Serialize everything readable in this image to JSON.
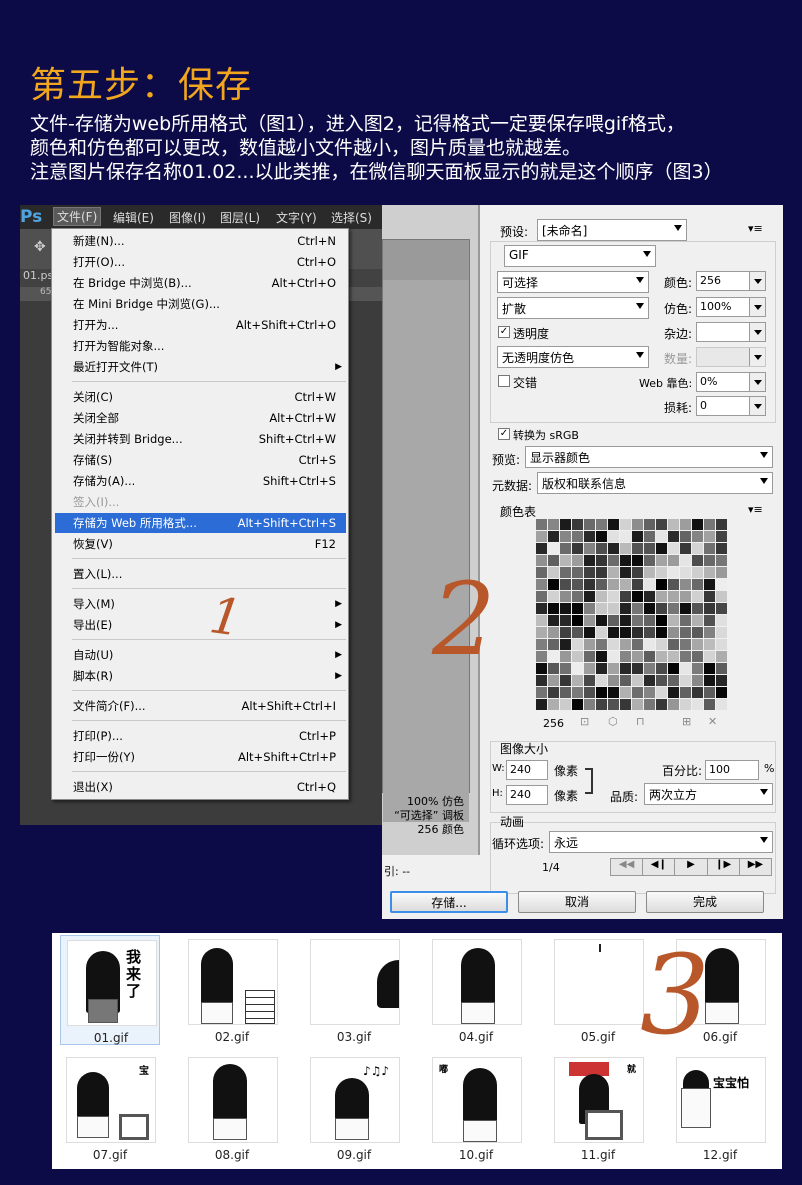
{
  "heading": "第五步：保存",
  "description": [
    "文件-存储为web所用格式（图1），进入图2，记得格式一定要保存喂gif格式，",
    "颜色和仿色都可以更改，数值越小文件越小，图片质量也就越差。",
    "注意图片保存名称01.02...以此类推，在微信聊天面板显示的就是这个顺序（图3）"
  ],
  "ps": {
    "logo": "Ps",
    "menubar": [
      "文件(F)",
      "编辑(E)",
      "图像(I)",
      "图层(L)",
      "文字(Y)",
      "选择(S)"
    ],
    "doc_tab": "01.ps",
    "ruler": "65",
    "menu_items": [
      {
        "label": "新建(N)...",
        "shortcut": "Ctrl+N"
      },
      {
        "label": "打开(O)...",
        "shortcut": "Ctrl+O"
      },
      {
        "label": "在 Bridge 中浏览(B)...",
        "shortcut": "Alt+Ctrl+O"
      },
      {
        "label": "在 Mini Bridge 中浏览(G)...",
        "shortcut": ""
      },
      {
        "label": "打开为...",
        "shortcut": "Alt+Shift+Ctrl+O"
      },
      {
        "label": "打开为智能对象...",
        "shortcut": ""
      },
      {
        "label": "最近打开文件(T)",
        "shortcut": ""
      },
      {
        "label": "关闭(C)",
        "shortcut": "Ctrl+W"
      },
      {
        "label": "关闭全部",
        "shortcut": "Alt+Ctrl+W"
      },
      {
        "label": "关闭并转到 Bridge...",
        "shortcut": "Shift+Ctrl+W"
      },
      {
        "label": "存储(S)",
        "shortcut": "Ctrl+S"
      },
      {
        "label": "存储为(A)...",
        "shortcut": "Shift+Ctrl+S"
      },
      {
        "label": "签入(I)...",
        "shortcut": ""
      },
      {
        "label": "存储为 Web 所用格式...",
        "shortcut": "Alt+Shift+Ctrl+S"
      },
      {
        "label": "恢复(V)",
        "shortcut": "F12"
      },
      {
        "label": "置入(L)...",
        "shortcut": ""
      },
      {
        "label": "导入(M)",
        "shortcut": ""
      },
      {
        "label": "导出(E)",
        "shortcut": ""
      },
      {
        "label": "自动(U)",
        "shortcut": ""
      },
      {
        "label": "脚本(R)",
        "shortcut": ""
      },
      {
        "label": "文件简介(F)...",
        "shortcut": "Alt+Shift+Ctrl+I"
      },
      {
        "label": "打印(P)...",
        "shortcut": "Ctrl+P"
      },
      {
        "label": "打印一份(Y)",
        "shortcut": "Alt+Shift+Ctrl+P"
      },
      {
        "label": "退出(X)",
        "shortcut": "Ctrl+Q"
      }
    ],
    "annotation": "1"
  },
  "sfw": {
    "preset_label": "预设:",
    "preset_value": "[未命名]",
    "format": "GIF",
    "reduction": "可选择",
    "dither_algo": "扩散",
    "transparency_label": "透明度",
    "matte_dither": "无透明度仿色",
    "interlaced_label": "交错",
    "colors_label": "颜色:",
    "colors_value": "256",
    "dither_label": "仿色:",
    "dither_value": "100%",
    "matte_label": "杂边:",
    "amount_label": "数量:",
    "web_snap_label": "Web 靠色:",
    "web_snap_value": "0%",
    "lossy_label": "损耗:",
    "lossy_value": "0",
    "srgb_label": "转换为 sRGB",
    "preview_label": "预览:",
    "preview_value": "显示器颜色",
    "metadata_label": "元数据:",
    "metadata_value": "版权和联系信息",
    "color_table_label": "颜色表",
    "color_count": "256",
    "image_size_label": "图像大小",
    "w_label": "W:",
    "w_value": "240",
    "h_label": "H:",
    "h_value": "240",
    "px": "像素",
    "percent_label": "百分比:",
    "percent_value": "100",
    "percent_sign": "%",
    "quality_label": "品质:",
    "quality_value": "两次立方",
    "animation_label": "动画",
    "loop_label": "循环选项:",
    "loop_value": "永远",
    "frame": "1/4",
    "info_lines": [
      "100% 仿色",
      "“可选择” 调板",
      "256 颜色"
    ],
    "info_bottom": "引: --",
    "save_button": "存储...",
    "cancel_button": "取消",
    "done_button": "完成",
    "annotation": "2"
  },
  "files": [
    "01.gif",
    "02.gif",
    "03.gif",
    "04.gif",
    "05.gif",
    "06.gif",
    "07.gif",
    "08.gif",
    "09.gif",
    "10.gif",
    "11.gif",
    "12.gif"
  ],
  "thumb_texts": {
    "t1": "我来了",
    "t7": "宝",
    "t10": "嘟",
    "t11": "就",
    "t12": "宝宝怕"
  },
  "annotation3": "3",
  "colors": {
    "background": "#0d0b47",
    "heading": "#f2a61e",
    "highlight": "#2b6cd6",
    "annotation": "#b8582a"
  }
}
